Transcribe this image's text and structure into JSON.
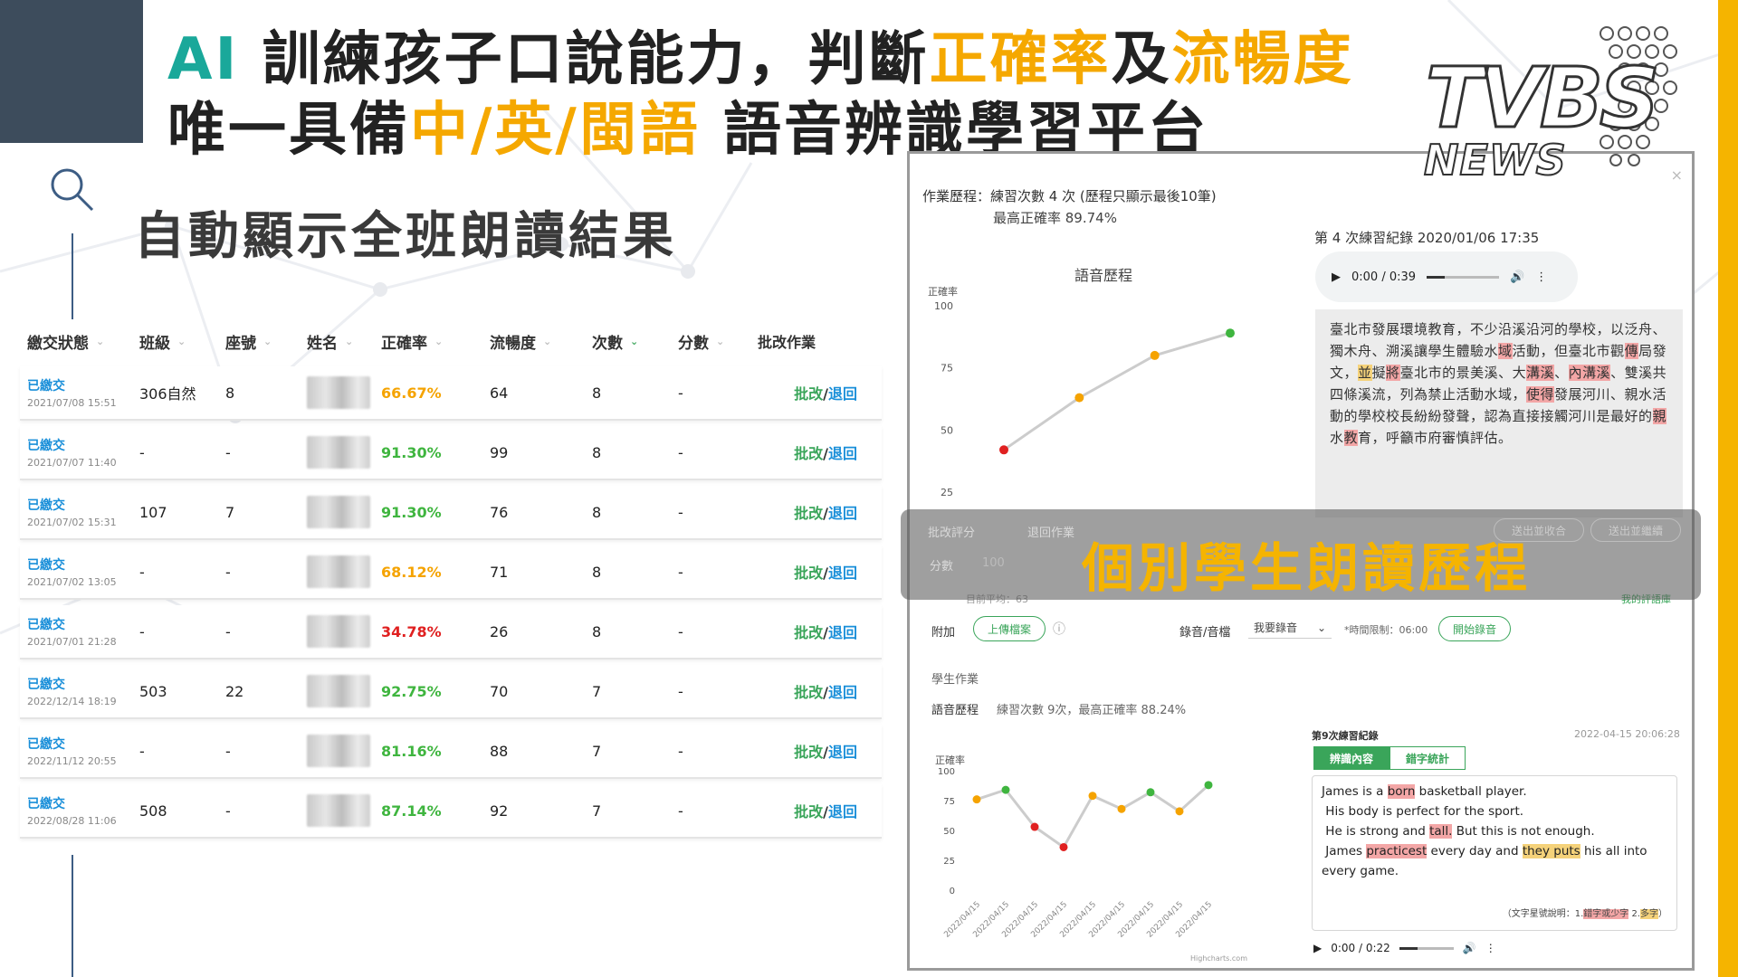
{
  "headline": {
    "line1_ai": "AI",
    "line1_a": " 訓練孩子口說能力，判斷",
    "line1_b": "正確率",
    "line1_c": "及",
    "line1_d": "流暢度",
    "line2_a": "唯一具備",
    "line2_b": "中/英/閩語",
    "line2_c": " 語音辨識學習平台"
  },
  "logo": {
    "main": "TVBS",
    "sub": "NEWS"
  },
  "section_title": "自動顯示全班朗讀結果",
  "table": {
    "headers": [
      "繳交狀態",
      "班級",
      "座號",
      "姓名",
      "正確率",
      "流暢度",
      "次數",
      "分數",
      "批改作業"
    ],
    "rows": [
      {
        "status": "已繳交",
        "date": "2021/07/08 15:51",
        "class": "306自然",
        "seat": "8",
        "rate": "66.67%",
        "rate_color": "orange",
        "fluency": "64",
        "count": "8",
        "score": "-"
      },
      {
        "status": "已繳交",
        "date": "2021/07/07 11:40",
        "class": "-",
        "seat": "-",
        "rate": "91.30%",
        "rate_color": "green",
        "fluency": "99",
        "count": "8",
        "score": "-"
      },
      {
        "status": "已繳交",
        "date": "2021/07/02 15:31",
        "class": "107",
        "seat": "7",
        "rate": "91.30%",
        "rate_color": "green",
        "fluency": "76",
        "count": "8",
        "score": "-"
      },
      {
        "status": "已繳交",
        "date": "2021/07/02 13:05",
        "class": "-",
        "seat": "-",
        "rate": "68.12%",
        "rate_color": "orange",
        "fluency": "71",
        "count": "8",
        "score": "-"
      },
      {
        "status": "已繳交",
        "date": "2021/07/01 21:28",
        "class": "-",
        "seat": "-",
        "rate": "34.78%",
        "rate_color": "red",
        "fluency": "26",
        "count": "8",
        "score": "-"
      },
      {
        "status": "已繳交",
        "date": "2022/12/14 18:19",
        "class": "503",
        "seat": "22",
        "rate": "92.75%",
        "rate_color": "green",
        "fluency": "70",
        "count": "7",
        "score": "-"
      },
      {
        "status": "已繳交",
        "date": "2022/11/12 20:55",
        "class": "-",
        "seat": "-",
        "rate": "81.16%",
        "rate_color": "green",
        "fluency": "88",
        "count": "7",
        "score": "-"
      },
      {
        "status": "已繳交",
        "date": "2022/08/28 11:06",
        "class": "508",
        "seat": "-",
        "rate": "87.14%",
        "rate_color": "green",
        "fluency": "92",
        "count": "7",
        "score": "-"
      }
    ],
    "action_grade": "批改",
    "action_sep": "/",
    "action_return": "退回"
  },
  "panel": {
    "close": "×",
    "history_line1": "作業歷程：練習次數 4 次 (歷程只顯示最後10筆)",
    "history_line2": "最高正確率 89.74%",
    "chart1_title": "語音歷程",
    "chart1_ylabel": "正確率",
    "chart1_ticks": [
      "100",
      "75",
      "50",
      "25"
    ],
    "chart1_values": [
      42,
      63,
      80,
      89
    ],
    "chart1_colors": [
      "#e02020",
      "#f5a300",
      "#f5a300",
      "#3fb53f"
    ],
    "record_title": "第 4 次練習紀錄 2020/01/06 17:35",
    "audio1_time": "0:00 / 0:39",
    "passage": [
      {
        "t": "臺北市發展環境教育，不少沿溪沿河的學校，以泛舟、獨木舟、溯溪讓學生體驗水"
      },
      {
        "t": "域",
        "m": "r"
      },
      {
        "t": "活動，但臺北市觀"
      },
      {
        "t": "傳",
        "m": "r"
      },
      {
        "t": "局發文，"
      },
      {
        "t": "並",
        "m": "y"
      },
      {
        "t": "擬"
      },
      {
        "t": "將",
        "m": "r"
      },
      {
        "t": "臺北市的景美溪、大"
      },
      {
        "t": "溝溪",
        "m": "r"
      },
      {
        "t": "、"
      },
      {
        "t": "內溝溪",
        "m": "r"
      },
      {
        "t": "、雙溪共四條溪流，列為禁止活動水域，"
      },
      {
        "t": "使得",
        "m": "r"
      },
      {
        "t": "發展河川、親水活動的學校校長紛紛發聲，認為直接接觸河川是最好的"
      },
      {
        "t": "親",
        "m": "r"
      },
      {
        "t": "水"
      },
      {
        "t": "教",
        "m": "r"
      },
      {
        "t": "育，呼籲市府審慎評估。"
      }
    ],
    "banner": {
      "text": "個別學生朗讀歷程",
      "tab_grade": "批改評分",
      "tab_return": "退回作業",
      "btn1": "送出並收合",
      "btn2": "送出並繼續",
      "score_label": "分數",
      "score_value": "100"
    },
    "avg_note": "目前平均：63",
    "my_reviews": "我的評語庫",
    "attach_label": "附加",
    "upload_btn": "上傳檔案",
    "record_label": "錄音/音檔",
    "record_select": "我要錄音",
    "time_limit": "*時間限制：06:00",
    "start_btn": "開始錄音",
    "student_work": "學生作業",
    "history2_label": "語音歷程",
    "history2_detail": "練習次數 9次，最高正確率 88.24%",
    "chart2_ylabel": "正確率",
    "chart2_ticks": [
      "100",
      "75",
      "50",
      "25",
      "0"
    ],
    "chart2_values": [
      76,
      84,
      53,
      36,
      79,
      68,
      82,
      66,
      88
    ],
    "chart2_colors": [
      "#f5a300",
      "#3fb53f",
      "#e02020",
      "#e02020",
      "#f5a300",
      "#f5a300",
      "#3fb53f",
      "#f5a300",
      "#3fb53f"
    ],
    "chart2_date": "2022/04/15",
    "chart2_credit": "Highcharts.com",
    "record2_title": "第9次練習紀錄",
    "record2_time": "2022-04-15 20:06:28",
    "tab_content": "辨識內容",
    "tab_stats": "錯字統計",
    "english_text": [
      {
        "t": "James is a "
      },
      {
        "t": "born",
        "m": "r"
      },
      {
        "t": " basketball player.",
        "br": true
      },
      {
        "t": "His body is perfect for the sport.",
        "br": true,
        "ind": true
      },
      {
        "t": "He is strong and ",
        "ind": true
      },
      {
        "t": "tall.",
        "m": "r"
      },
      {
        "t": " But this is not enough.",
        "br": true
      },
      {
        "t": "James ",
        "ind": true
      },
      {
        "t": "practicest",
        "m": "r"
      },
      {
        "t": " every day and "
      },
      {
        "t": "they puts",
        "m": "y"
      },
      {
        "t": " his all into every game."
      }
    ],
    "legend_text": "（文字星號說明：1.",
    "legend_red": "錯字或少字",
    "legend_mid": " 2.",
    "legend_yellow": "多字",
    "legend_end": "）",
    "audio2_time": "0:00 / 0:22"
  }
}
